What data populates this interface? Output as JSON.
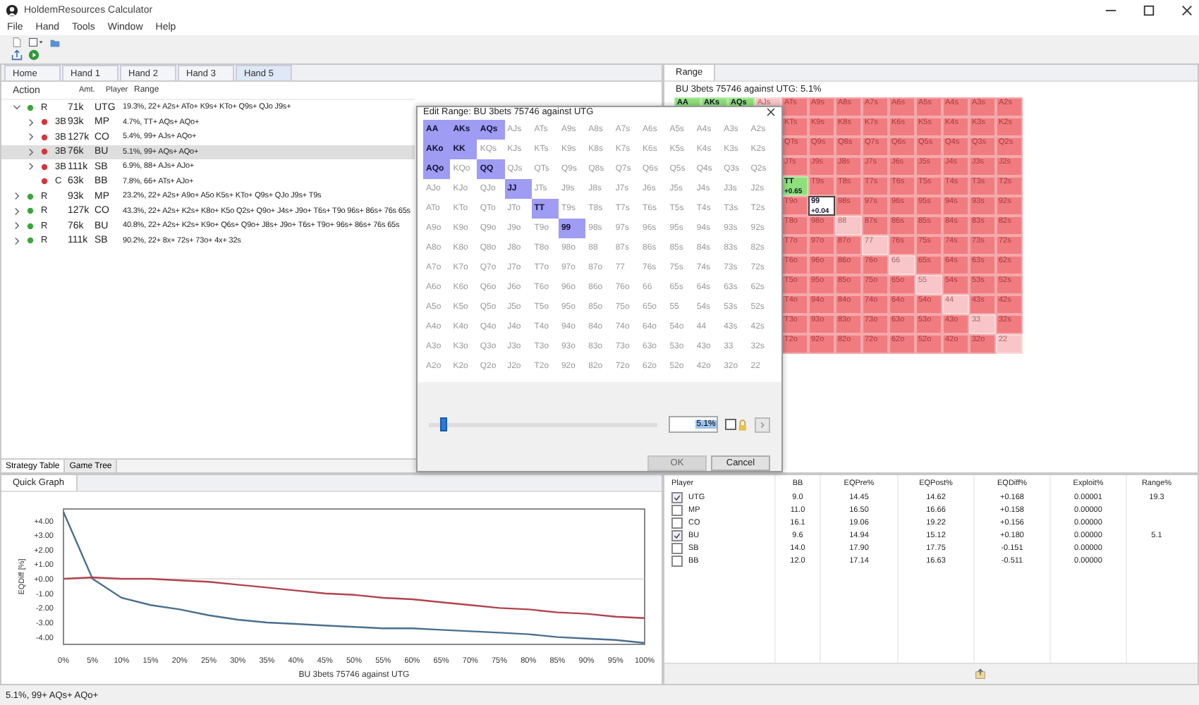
{
  "window": {
    "title": "HoldemResources Calculator"
  },
  "menu": [
    "File",
    "Hand",
    "Tools",
    "Window",
    "Help"
  ],
  "tabs": [
    {
      "label": "Home",
      "selected": false
    },
    {
      "label": "Hand 1",
      "selected": false
    },
    {
      "label": "Hand 2",
      "selected": false
    },
    {
      "label": "Hand 3",
      "selected": false
    },
    {
      "label": "Hand 5",
      "selected": true
    }
  ],
  "strategy_table": {
    "columns": [
      "Action",
      "Amt.",
      "Player",
      "Range"
    ],
    "rows": [
      {
        "action": "R",
        "amount": "71k",
        "player": "UTG",
        "range": "19.3%, 22+ A2s+ ATo+ K9s+ KTo+ Q9s+ QJo J9s+",
        "color": "#3aa63a",
        "expanded": true,
        "selected": false,
        "children": [
          {
            "action": "3B",
            "amount": "93k",
            "player": "MP",
            "range": "4.7%, TT+ AQs+ AQo+",
            "color": "#d8343c",
            "expanded": false,
            "selected": false
          },
          {
            "action": "3B",
            "amount": "127k",
            "player": "CO",
            "range": "5.4%, 99+ AJs+ AQo+",
            "color": "#d8343c",
            "expanded": false,
            "selected": false
          },
          {
            "action": "3B",
            "amount": "76k",
            "player": "BU",
            "range": "5.1%, 99+ AQs+ AQo+",
            "color": "#d8343c",
            "expanded": false,
            "selected": true
          },
          {
            "action": "3B",
            "amount": "111k",
            "player": "SB",
            "range": "6.9%, 88+ AJs+ AJo+",
            "color": "#d8343c",
            "expanded": false,
            "selected": false
          },
          {
            "action": "C",
            "amount": "63k",
            "player": "BB",
            "range": "7.8%, 66+ ATs+ AJo+",
            "color": "#d8343c",
            "selected": false
          }
        ]
      },
      {
        "action": "R",
        "amount": "93k",
        "player": "MP",
        "range": "23.2%, 22+ A2s+ A9o+ A5o K5s+ KTo+ Q9s+ QJo J9s+ T9s",
        "color": "#3aa63a",
        "expanded": false,
        "selected": false
      },
      {
        "action": "R",
        "amount": "127k",
        "player": "CO",
        "range": "43.3%, 22+ A2s+ K2s+ K8o+ K5o Q2s+ Q9o+ J4s+ J9o+ T6s+ T9o 96s+ 86s+ 76s 65s",
        "color": "#3aa63a",
        "expanded": false,
        "selected": false
      },
      {
        "action": "R",
        "amount": "76k",
        "player": "BU",
        "range": "40.8%, 22+ A2s+ K2s+ K9o+ Q6s+ Q9o+ J8s+ J9o+ T6s+ T9o+ 96s+ 86s+ 76s 65s",
        "color": "#3aa63a",
        "expanded": false,
        "selected": false
      },
      {
        "action": "R",
        "amount": "111k",
        "player": "SB",
        "range": "90.2%, 22+ 8x+ 72s+ 73o+ 4x+ 32s",
        "color": "#3aa63a",
        "expanded": false,
        "selected": false
      }
    ]
  },
  "bottom_tabs": [
    {
      "label": "Strategy Table",
      "selected": true
    },
    {
      "label": "Game Tree",
      "selected": false
    }
  ],
  "range_panel": {
    "tab": "Range",
    "heading": "BU 3bets 75746 against UTG: 5.1%",
    "grid": [
      [
        {
          "hand": "AA",
          "kind": "range"
        },
        {
          "hand": "AKs",
          "kind": "range"
        },
        {
          "hand": "AQs",
          "kind": "range"
        },
        {
          "hand": "AJs",
          "kind": "light"
        },
        {
          "hand": "ATs",
          "kind": "other"
        },
        {
          "hand": "A9s",
          "kind": "other"
        },
        {
          "hand": "A8s",
          "kind": "other"
        },
        {
          "hand": "A7s",
          "kind": "other"
        },
        {
          "hand": "A6s",
          "kind": "other"
        },
        {
          "hand": "A5s",
          "kind": "other"
        },
        {
          "hand": "A4s",
          "kind": "other"
        },
        {
          "hand": "A3s",
          "kind": "other"
        },
        {
          "hand": "A2s",
          "kind": "other"
        }
      ],
      [
        {
          "hand": "KTs",
          "kind": "other"
        },
        {
          "hand": "K9s",
          "kind": "other"
        },
        {
          "hand": "K8s",
          "kind": "other"
        },
        {
          "hand": "K7s",
          "kind": "other"
        },
        {
          "hand": "K6s",
          "kind": "other"
        },
        {
          "hand": "K5s",
          "kind": "other"
        },
        {
          "hand": "K4s",
          "kind": "other"
        },
        {
          "hand": "K3s",
          "kind": "other"
        },
        {
          "hand": "K2s",
          "kind": "other"
        }
      ],
      [
        {
          "hand": "QTs",
          "kind": "other"
        },
        {
          "hand": "Q9s",
          "kind": "other"
        },
        {
          "hand": "Q8s",
          "kind": "other"
        },
        {
          "hand": "Q7s",
          "kind": "other"
        },
        {
          "hand": "Q6s",
          "kind": "other"
        },
        {
          "hand": "Q5s",
          "kind": "other"
        },
        {
          "hand": "Q4s",
          "kind": "other"
        },
        {
          "hand": "Q3s",
          "kind": "other"
        },
        {
          "hand": "Q2s",
          "kind": "other"
        }
      ],
      [
        {
          "hand": "JTs",
          "kind": "other"
        },
        {
          "hand": "J9s",
          "kind": "other"
        },
        {
          "hand": "J8s",
          "kind": "other"
        },
        {
          "hand": "J7s",
          "kind": "other"
        },
        {
          "hand": "J6s",
          "kind": "other"
        },
        {
          "hand": "J5s",
          "kind": "other"
        },
        {
          "hand": "J4s",
          "kind": "other"
        },
        {
          "hand": "J3s",
          "kind": "other"
        },
        {
          "hand": "J2s",
          "kind": "other"
        }
      ],
      [
        {
          "hand": "TT",
          "kind": "range",
          "value": "+0.65"
        },
        {
          "hand": "T9s",
          "kind": "other"
        },
        {
          "hand": "T8s",
          "kind": "other"
        },
        {
          "hand": "T7s",
          "kind": "other"
        },
        {
          "hand": "T6s",
          "kind": "other"
        },
        {
          "hand": "T5s",
          "kind": "other"
        },
        {
          "hand": "T4s",
          "kind": "other"
        },
        {
          "hand": "T3s",
          "kind": "other"
        },
        {
          "hand": "T2s",
          "kind": "other"
        }
      ],
      [
        {
          "hand": "T9o",
          "kind": "other"
        },
        {
          "hand": "99",
          "kind": "edge",
          "value": "+0.04"
        },
        {
          "hand": "98s",
          "kind": "other"
        },
        {
          "hand": "97s",
          "kind": "other"
        },
        {
          "hand": "96s",
          "kind": "other"
        },
        {
          "hand": "95s",
          "kind": "other"
        },
        {
          "hand": "94s",
          "kind": "other"
        },
        {
          "hand": "93s",
          "kind": "other"
        },
        {
          "hand": "92s",
          "kind": "other"
        }
      ],
      [
        {
          "hand": "T8o",
          "kind": "other"
        },
        {
          "hand": "98o",
          "kind": "other"
        },
        {
          "hand": "88",
          "kind": "light"
        },
        {
          "hand": "87s",
          "kind": "other"
        },
        {
          "hand": "86s",
          "kind": "other"
        },
        {
          "hand": "85s",
          "kind": "other"
        },
        {
          "hand": "84s",
          "kind": "other"
        },
        {
          "hand": "83s",
          "kind": "other"
        },
        {
          "hand": "82s",
          "kind": "other"
        }
      ],
      [
        {
          "hand": "T7o",
          "kind": "other"
        },
        {
          "hand": "97o",
          "kind": "other"
        },
        {
          "hand": "87o",
          "kind": "other"
        },
        {
          "hand": "77",
          "kind": "light"
        },
        {
          "hand": "76s",
          "kind": "other"
        },
        {
          "hand": "75s",
          "kind": "other"
        },
        {
          "hand": "74s",
          "kind": "other"
        },
        {
          "hand": "73s",
          "kind": "other"
        },
        {
          "hand": "72s",
          "kind": "other"
        }
      ],
      [
        {
          "hand": "T6o",
          "kind": "other"
        },
        {
          "hand": "96o",
          "kind": "other"
        },
        {
          "hand": "86o",
          "kind": "other"
        },
        {
          "hand": "76o",
          "kind": "other"
        },
        {
          "hand": "66",
          "kind": "light"
        },
        {
          "hand": "65s",
          "kind": "other"
        },
        {
          "hand": "64s",
          "kind": "other"
        },
        {
          "hand": "63s",
          "kind": "other"
        },
        {
          "hand": "62s",
          "kind": "other"
        }
      ],
      [
        {
          "hand": "T5o",
          "kind": "other"
        },
        {
          "hand": "95o",
          "kind": "other"
        },
        {
          "hand": "85o",
          "kind": "other"
        },
        {
          "hand": "75o",
          "kind": "other"
        },
        {
          "hand": "65o",
          "kind": "other"
        },
        {
          "hand": "55",
          "kind": "light"
        },
        {
          "hand": "54s",
          "kind": "other"
        },
        {
          "hand": "53s",
          "kind": "other"
        },
        {
          "hand": "52s",
          "kind": "other"
        }
      ],
      [
        {
          "hand": "T4o",
          "kind": "other"
        },
        {
          "hand": "94o",
          "kind": "other"
        },
        {
          "hand": "84o",
          "kind": "other"
        },
        {
          "hand": "74o",
          "kind": "other"
        },
        {
          "hand": "64o",
          "kind": "other"
        },
        {
          "hand": "54o",
          "kind": "other"
        },
        {
          "hand": "44",
          "kind": "light"
        },
        {
          "hand": "43s",
          "kind": "other"
        },
        {
          "hand": "42s",
          "kind": "other"
        }
      ],
      [
        {
          "hand": "T3o",
          "kind": "other"
        },
        {
          "hand": "93o",
          "kind": "other"
        },
        {
          "hand": "83o",
          "kind": "other"
        },
        {
          "hand": "73o",
          "kind": "other"
        },
        {
          "hand": "63o",
          "kind": "other"
        },
        {
          "hand": "53o",
          "kind": "other"
        },
        {
          "hand": "43o",
          "kind": "other"
        },
        {
          "hand": "33",
          "kind": "light"
        },
        {
          "hand": "32s",
          "kind": "other"
        }
      ],
      [
        {
          "hand": "T2o",
          "kind": "other"
        },
        {
          "hand": "92o",
          "kind": "other"
        },
        {
          "hand": "82o",
          "kind": "other"
        },
        {
          "hand": "72o",
          "kind": "other"
        },
        {
          "hand": "62o",
          "kind": "other"
        },
        {
          "hand": "52o",
          "kind": "other"
        },
        {
          "hand": "42o",
          "kind": "other"
        },
        {
          "hand": "32o",
          "kind": "other"
        },
        {
          "hand": "22",
          "kind": "light"
        }
      ]
    ]
  },
  "quick_graph": {
    "tab": "Quick Graph",
    "chart_data": {
      "type": "line",
      "xlabel": "BU 3bets 75746 against UTG",
      "ylabel": "EQDiff [%]",
      "x": [
        0,
        5,
        10,
        15,
        20,
        25,
        30,
        35,
        40,
        45,
        50,
        55,
        60,
        65,
        70,
        75,
        80,
        85,
        90,
        95,
        100
      ],
      "series": [
        {
          "color": "#4a6f8c",
          "values": [
            4.6,
            0.0,
            -1.3,
            -1.8,
            -2.1,
            -2.5,
            -2.8,
            -3.0,
            -3.1,
            -3.2,
            -3.3,
            -3.4,
            -3.4,
            -3.5,
            -3.6,
            -3.7,
            -3.8,
            -4.0,
            -4.1,
            -4.2,
            -4.4
          ]
        },
        {
          "color": "#b0444c",
          "values": [
            0.0,
            0.1,
            0.0,
            0.0,
            -0.1,
            -0.2,
            -0.4,
            -0.6,
            -0.8,
            -1.0,
            -1.1,
            -1.3,
            -1.4,
            -1.6,
            -1.8,
            -2.0,
            -2.1,
            -2.3,
            -2.4,
            -2.6,
            -2.7
          ]
        }
      ],
      "xlim": [
        0,
        100
      ],
      "ylim": [
        -4.5,
        4.8
      ],
      "xticks": [
        {
          "value": 0,
          "label": "0%"
        },
        {
          "value": 5,
          "label": "5%"
        },
        {
          "value": 10,
          "label": "10%"
        },
        {
          "value": 15,
          "label": "15%"
        },
        {
          "value": 20,
          "label": "20%"
        },
        {
          "value": 25,
          "label": "25%"
        },
        {
          "value": 30,
          "label": "30%"
        },
        {
          "value": 35,
          "label": "35%"
        },
        {
          "value": 40,
          "label": "40%"
        },
        {
          "value": 45,
          "label": "45%"
        },
        {
          "value": 50,
          "label": "50%"
        },
        {
          "value": 55,
          "label": "55%"
        },
        {
          "value": 60,
          "label": "60%"
        },
        {
          "value": 65,
          "label": "65%"
        },
        {
          "value": 70,
          "label": "70%"
        },
        {
          "value": 75,
          "label": "75%"
        },
        {
          "value": 80,
          "label": "80%"
        },
        {
          "value": 85,
          "label": "85%"
        },
        {
          "value": 90,
          "label": "90%"
        },
        {
          "value": 95,
          "label": "95%"
        },
        {
          "value": 100,
          "label": "100%"
        }
      ],
      "yticks": [
        {
          "value": 4,
          "label": "+4.00"
        },
        {
          "value": 3,
          "label": "+3.00"
        },
        {
          "value": 2,
          "label": "+2.00"
        },
        {
          "value": 1,
          "label": "+1.00"
        },
        {
          "value": 0,
          "label": "+0.00"
        },
        {
          "value": -1,
          "label": "-1.00"
        },
        {
          "value": -2,
          "label": "-2.00"
        },
        {
          "value": -3,
          "label": "-3.00"
        },
        {
          "value": -4,
          "label": "-4.00"
        }
      ]
    }
  },
  "stats_table": {
    "columns": [
      "Player",
      "BB",
      "EQPre%",
      "EQPost%",
      "EQDiff%",
      "Exploit%",
      "Range%"
    ],
    "rows": [
      {
        "checked": true,
        "cells": [
          "UTG",
          "9.0",
          "14.45",
          "14.62",
          "+0.168",
          "0.00001",
          "19.3"
        ]
      },
      {
        "checked": false,
        "cells": [
          "MP",
          "11.0",
          "16.50",
          "16.66",
          "+0.158",
          "0.00000"
        ]
      },
      {
        "checked": false,
        "cells": [
          "CO",
          "16.1",
          "19.06",
          "19.22",
          "+0.156",
          "0.00000"
        ]
      },
      {
        "checked": true,
        "cells": [
          "BU",
          "9.6",
          "14.94",
          "15.12",
          "+0.180",
          "0.00000",
          "5.1"
        ]
      },
      {
        "checked": false,
        "cells": [
          "SB",
          "14.0",
          "17.90",
          "17.75",
          "-0.151",
          "0.00000"
        ]
      },
      {
        "checked": false,
        "cells": [
          "BB",
          "12.0",
          "17.14",
          "16.63",
          "-0.511",
          "0.00000"
        ]
      }
    ]
  },
  "dialog": {
    "title": "Edit Range: BU 3bets 75746 against UTG",
    "grid": [
      [
        {
          "hand": "AA",
          "selected": true
        },
        {
          "hand": "AKs",
          "selected": true
        },
        {
          "hand": "AQs",
          "selected": true
        },
        {
          "hand": "AJs",
          "selected": false
        },
        {
          "hand": "ATs",
          "selected": false
        },
        {
          "hand": "A9s",
          "selected": false
        },
        {
          "hand": "A8s",
          "selected": false
        },
        {
          "hand": "A7s",
          "selected": false
        },
        {
          "hand": "A6s",
          "selected": false
        },
        {
          "hand": "A5s",
          "selected": false
        },
        {
          "hand": "A4s",
          "selected": false
        },
        {
          "hand": "A3s",
          "selected": false
        },
        {
          "hand": "A2s",
          "selected": false
        }
      ],
      [
        {
          "hand": "AKo",
          "selected": true
        },
        {
          "hand": "KK",
          "selected": true
        },
        {
          "hand": "KQs",
          "selected": false
        },
        {
          "hand": "KJs",
          "selected": false
        },
        {
          "hand": "KTs",
          "selected": false
        },
        {
          "hand": "K9s",
          "selected": false
        },
        {
          "hand": "K8s",
          "selected": false
        },
        {
          "hand": "K7s",
          "selected": false
        },
        {
          "hand": "K6s",
          "selected": false
        },
        {
          "hand": "K5s",
          "selected": false
        },
        {
          "hand": "K4s",
          "selected": false
        },
        {
          "hand": "K3s",
          "selected": false
        },
        {
          "hand": "K2s",
          "selected": false
        }
      ],
      [
        {
          "hand": "AQo",
          "selected": true
        },
        {
          "hand": "KQo",
          "selected": false
        },
        {
          "hand": "QQ",
          "selected": true
        },
        {
          "hand": "QJs",
          "selected": false
        },
        {
          "hand": "QTs",
          "selected": false
        },
        {
          "hand": "Q9s",
          "selected": false
        },
        {
          "hand": "Q8s",
          "selected": false
        },
        {
          "hand": "Q7s",
          "selected": false
        },
        {
          "hand": "Q6s",
          "selected": false
        },
        {
          "hand": "Q5s",
          "selected": false
        },
        {
          "hand": "Q4s",
          "selected": false
        },
        {
          "hand": "Q3s",
          "selected": false
        },
        {
          "hand": "Q2s",
          "selected": false
        }
      ],
      [
        {
          "hand": "AJo",
          "selected": false
        },
        {
          "hand": "KJo",
          "selected": false
        },
        {
          "hand": "QJo",
          "selected": false
        },
        {
          "hand": "JJ",
          "selected": true
        },
        {
          "hand": "JTs",
          "selected": false
        },
        {
          "hand": "J9s",
          "selected": false
        },
        {
          "hand": "J8s",
          "selected": false
        },
        {
          "hand": "J7s",
          "selected": false
        },
        {
          "hand": "J6s",
          "selected": false
        },
        {
          "hand": "J5s",
          "selected": false
        },
        {
          "hand": "J4s",
          "selected": false
        },
        {
          "hand": "J3s",
          "selected": false
        },
        {
          "hand": "J2s",
          "selected": false
        }
      ],
      [
        {
          "hand": "ATo",
          "selected": false
        },
        {
          "hand": "KTo",
          "selected": false
        },
        {
          "hand": "QTo",
          "selected": false
        },
        {
          "hand": "JTo",
          "selected": false
        },
        {
          "hand": "TT",
          "selected": true
        },
        {
          "hand": "T9s",
          "selected": false
        },
        {
          "hand": "T8s",
          "selected": false
        },
        {
          "hand": "T7s",
          "selected": false
        },
        {
          "hand": "T6s",
          "selected": false
        },
        {
          "hand": "T5s",
          "selected": false
        },
        {
          "hand": "T4s",
          "selected": false
        },
        {
          "hand": "T3s",
          "selected": false
        },
        {
          "hand": "T2s",
          "selected": false
        }
      ],
      [
        {
          "hand": "A9o",
          "selected": false
        },
        {
          "hand": "K9o",
          "selected": false
        },
        {
          "hand": "Q9o",
          "selected": false
        },
        {
          "hand": "J9o",
          "selected": false
        },
        {
          "hand": "T9o",
          "selected": false
        },
        {
          "hand": "99",
          "selected": true
        },
        {
          "hand": "98s",
          "selected": false
        },
        {
          "hand": "97s",
          "selected": false
        },
        {
          "hand": "96s",
          "selected": false
        },
        {
          "hand": "95s",
          "selected": false
        },
        {
          "hand": "94s",
          "selected": false
        },
        {
          "hand": "93s",
          "selected": false
        },
        {
          "hand": "92s",
          "selected": false
        }
      ],
      [
        {
          "hand": "A8o",
          "selected": false
        },
        {
          "hand": "K8o",
          "selected": false
        },
        {
          "hand": "Q8o",
          "selected": false
        },
        {
          "hand": "J8o",
          "selected": false
        },
        {
          "hand": "T8o",
          "selected": false
        },
        {
          "hand": "98o",
          "selected": false
        },
        {
          "hand": "88",
          "selected": false
        },
        {
          "hand": "87s",
          "selected": false
        },
        {
          "hand": "86s",
          "selected": false
        },
        {
          "hand": "85s",
          "selected": false
        },
        {
          "hand": "84s",
          "selected": false
        },
        {
          "hand": "83s",
          "selected": false
        },
        {
          "hand": "82s",
          "selected": false
        }
      ],
      [
        {
          "hand": "A7o",
          "selected": false
        },
        {
          "hand": "K7o",
          "selected": false
        },
        {
          "hand": "Q7o",
          "selected": false
        },
        {
          "hand": "J7o",
          "selected": false
        },
        {
          "hand": "T7o",
          "selected": false
        },
        {
          "hand": "97o",
          "selected": false
        },
        {
          "hand": "87o",
          "selected": false
        },
        {
          "hand": "77",
          "selected": false
        },
        {
          "hand": "76s",
          "selected": false
        },
        {
          "hand": "75s",
          "selected": false
        },
        {
          "hand": "74s",
          "selected": false
        },
        {
          "hand": "73s",
          "selected": false
        },
        {
          "hand": "72s",
          "selected": false
        }
      ],
      [
        {
          "hand": "A6o",
          "selected": false
        },
        {
          "hand": "K6o",
          "selected": false
        },
        {
          "hand": "Q6o",
          "selected": false
        },
        {
          "hand": "J6o",
          "selected": false
        },
        {
          "hand": "T6o",
          "selected": false
        },
        {
          "hand": "96o",
          "selected": false
        },
        {
          "hand": "86o",
          "selected": false
        },
        {
          "hand": "76o",
          "selected": false
        },
        {
          "hand": "66",
          "selected": false
        },
        {
          "hand": "65s",
          "selected": false
        },
        {
          "hand": "64s",
          "selected": false
        },
        {
          "hand": "63s",
          "selected": false
        },
        {
          "hand": "62s",
          "selected": false
        }
      ],
      [
        {
          "hand": "A5o",
          "selected": false
        },
        {
          "hand": "K5o",
          "selected": false
        },
        {
          "hand": "Q5o",
          "selected": false
        },
        {
          "hand": "J5o",
          "selected": false
        },
        {
          "hand": "T5o",
          "selected": false
        },
        {
          "hand": "95o",
          "selected": false
        },
        {
          "hand": "85o",
          "selected": false
        },
        {
          "hand": "75o",
          "selected": false
        },
        {
          "hand": "65o",
          "selected": false
        },
        {
          "hand": "55",
          "selected": false
        },
        {
          "hand": "54s",
          "selected": false
        },
        {
          "hand": "53s",
          "selected": false
        },
        {
          "hand": "52s",
          "selected": false
        }
      ],
      [
        {
          "hand": "A4o",
          "selected": false
        },
        {
          "hand": "K4o",
          "selected": false
        },
        {
          "hand": "Q4o",
          "selected": false
        },
        {
          "hand": "J4o",
          "selected": false
        },
        {
          "hand": "T4o",
          "selected": false
        },
        {
          "hand": "94o",
          "selected": false
        },
        {
          "hand": "84o",
          "selected": false
        },
        {
          "hand": "74o",
          "selected": false
        },
        {
          "hand": "64o",
          "selected": false
        },
        {
          "hand": "54o",
          "selected": false
        },
        {
          "hand": "44",
          "selected": false
        },
        {
          "hand": "43s",
          "selected": false
        },
        {
          "hand": "42s",
          "selected": false
        }
      ],
      [
        {
          "hand": "A3o",
          "selected": false
        },
        {
          "hand": "K3o",
          "selected": false
        },
        {
          "hand": "Q3o",
          "selected": false
        },
        {
          "hand": "J3o",
          "selected": false
        },
        {
          "hand": "T3o",
          "selected": false
        },
        {
          "hand": "93o",
          "selected": false
        },
        {
          "hand": "83o",
          "selected": false
        },
        {
          "hand": "73o",
          "selected": false
        },
        {
          "hand": "63o",
          "selected": false
        },
        {
          "hand": "53o",
          "selected": false
        },
        {
          "hand": "43o",
          "selected": false
        },
        {
          "hand": "33",
          "selected": false
        },
        {
          "hand": "32s",
          "selected": false
        }
      ],
      [
        {
          "hand": "A2o",
          "selected": false
        },
        {
          "hand": "K2o",
          "selected": false
        },
        {
          "hand": "Q2o",
          "selected": false
        },
        {
          "hand": "J2o",
          "selected": false
        },
        {
          "hand": "T2o",
          "selected": false
        },
        {
          "hand": "92o",
          "selected": false
        },
        {
          "hand": "82o",
          "selected": false
        },
        {
          "hand": "72o",
          "selected": false
        },
        {
          "hand": "62o",
          "selected": false
        },
        {
          "hand": "52o",
          "selected": false
        },
        {
          "hand": "42o",
          "selected": false
        },
        {
          "hand": "32o",
          "selected": false
        },
        {
          "hand": "22",
          "selected": false
        }
      ]
    ],
    "slider": {
      "level": 0.05
    },
    "percent_field": {
      "value": "5.1%"
    },
    "lock": {
      "checked": false
    },
    "ok": {
      "label": "OK",
      "disabled": true
    },
    "cancel": {
      "label": "Cancel",
      "disabled": false
    }
  },
  "status_bar": "5.1%, 99+ AQs+ AQo+"
}
